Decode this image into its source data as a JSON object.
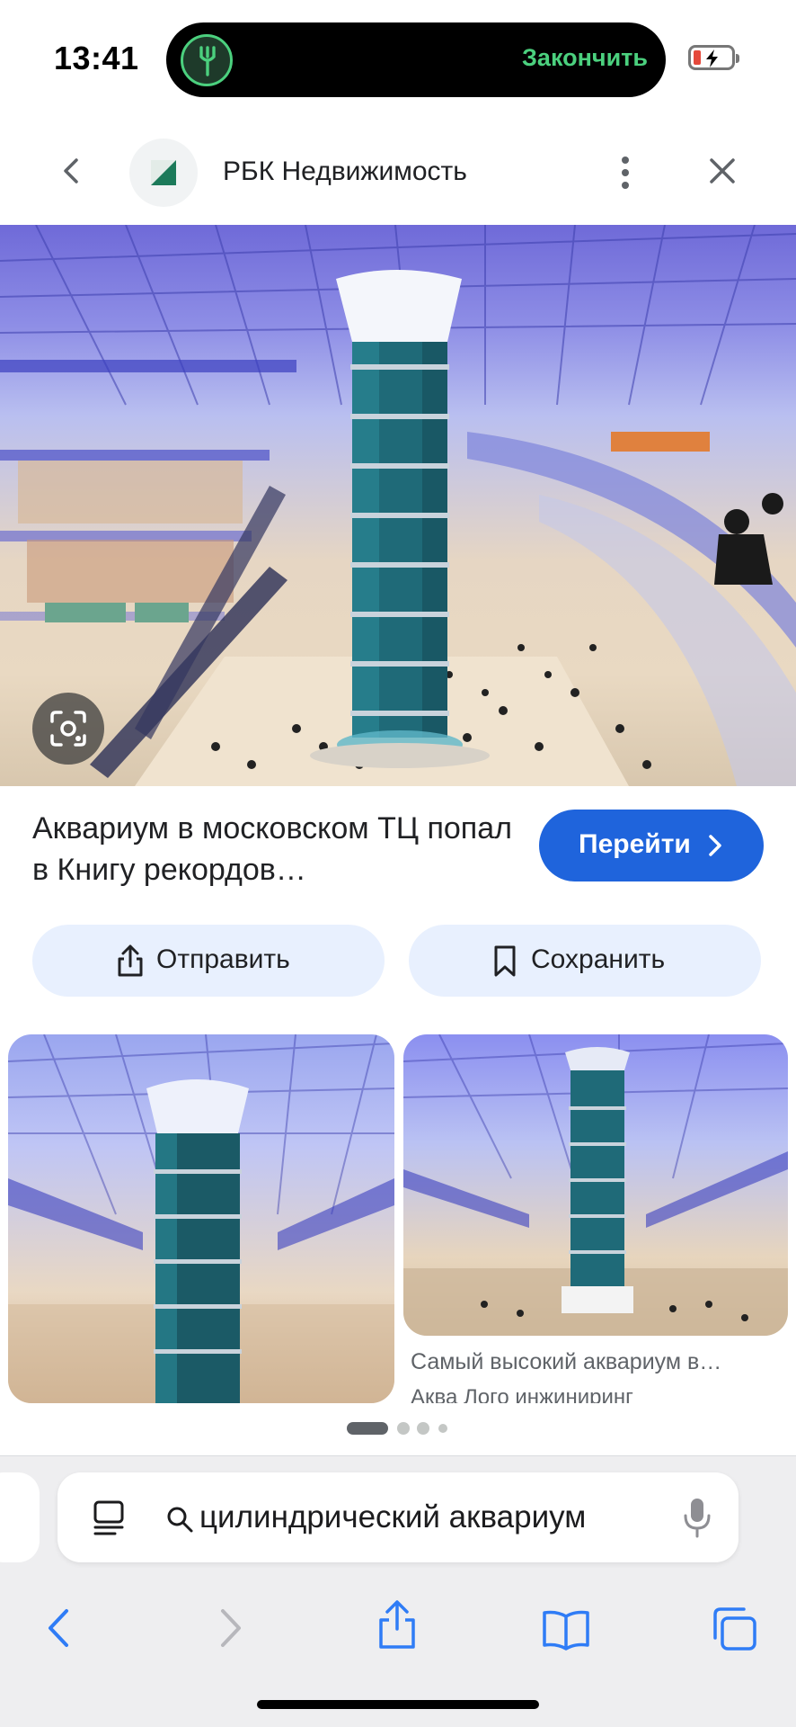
{
  "status_bar": {
    "time": "13:41",
    "live_activity_action": "Закончить"
  },
  "source": {
    "name": "РБК Недвижимость"
  },
  "result": {
    "title": "Аквариум в московском ТЦ попал в Книгу рекордов…",
    "go_button": "Перейти"
  },
  "actions": {
    "share": "Отправить",
    "save": "Сохранить"
  },
  "related": {
    "item2_caption": "Самый высокий аквариум в…",
    "item2_source": "Аква Лого инжиниринг"
  },
  "pager": {
    "dot_count": 4,
    "active_index": 0
  },
  "browser": {
    "address_text": "цилиндрический аквариум"
  },
  "colors": {
    "accent": "#1f64dc",
    "chip_bg": "#e8f0fe",
    "live_activity_green": "#4bd07e",
    "safari_blue": "#2f7cf6"
  }
}
